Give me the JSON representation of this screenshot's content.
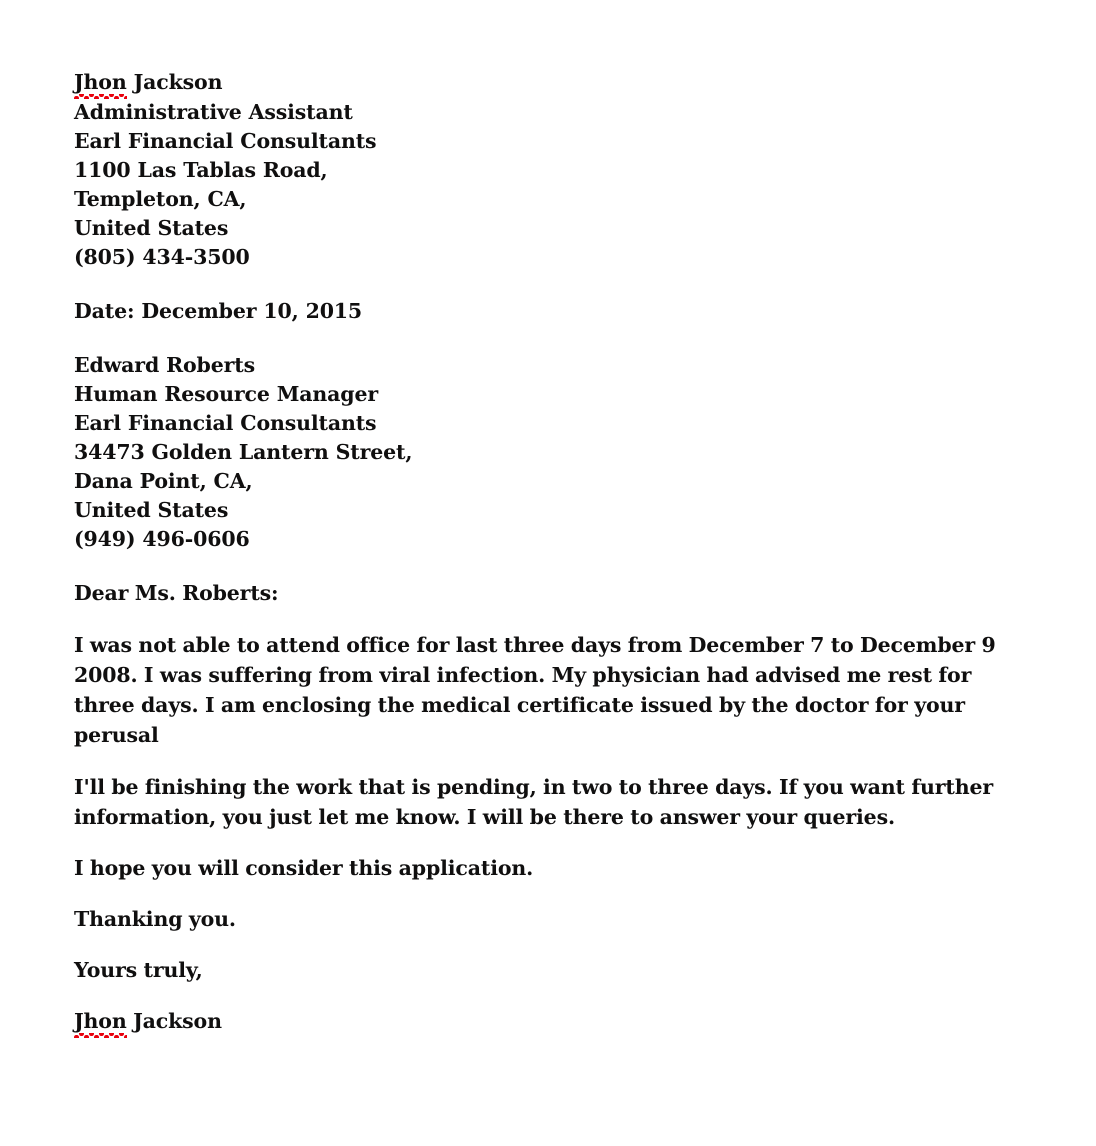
{
  "document": {
    "type": "sick-leave-letter",
    "background_color": "#ffffff",
    "text_color": "#100f0f",
    "spellcheck_underline_color": "#e8000d"
  },
  "sender": {
    "name_misspelled_part": "Jhon",
    "name_rest": " Jackson",
    "title": "Administrative Assistant",
    "company": "Earl Financial Consultants",
    "street": "1100 Las Tablas Road,",
    "city_state": "Templeton, CA,",
    "country": "United States",
    "phone": "(805) 434-3500"
  },
  "date_line": {
    "text": "Date: December 10, 2015"
  },
  "recipient": {
    "name": "Edward Roberts",
    "title": "Human Resource Manager",
    "company": "Earl Financial Consultants",
    "street": "34473 Golden Lantern Street,",
    "city_state": "Dana Point, CA,",
    "country": "United States",
    "phone": "(949) 496-0606"
  },
  "salutation": {
    "text": "Dear Ms. Roberts:"
  },
  "body": {
    "paragraph_1": "I was not able to attend office for last three days from December 7 to December 9 2008. I was suffering from viral infection. My physician had advised me rest for three days. I am enclosing the medical certificate issued by the doctor for your perusal",
    "paragraph_2": "I'll be finishing the work that is pending, in two to three days. If you want further information, you just let me know.  I will be there to answer your queries.",
    "paragraph_3": "I hope you will consider this application.",
    "paragraph_4": "Thanking you."
  },
  "closing": {
    "valediction": "Yours truly,",
    "signature_misspelled_part": "Jhon",
    "signature_rest": " Jackson"
  }
}
